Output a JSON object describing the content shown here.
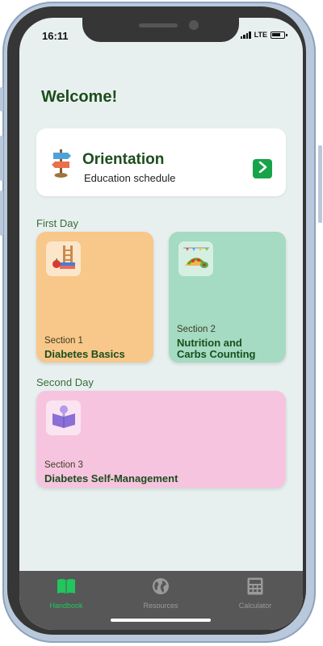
{
  "status_bar": {
    "time": "16:11",
    "network": "LTE"
  },
  "header": {
    "title": "Welcome!"
  },
  "orientation": {
    "title": "Orientation",
    "subtitle": "Education schedule",
    "icon": "signpost-icon"
  },
  "groups": [
    {
      "label": "First Day"
    },
    {
      "label": "Second Day"
    }
  ],
  "sections": [
    {
      "section_label": "Section 1",
      "title": "Diabetes Basics",
      "title_line2": "",
      "color": "#f8c78a",
      "icon": "books-icon"
    },
    {
      "section_label": "Section 2",
      "title": "Nutrition and",
      "title_line2": "Carbs Counting",
      "color": "#a4dbc2",
      "icon": "taco-icon"
    },
    {
      "section_label": "Section 3",
      "title": "Diabetes Self-Management",
      "title_line2": "",
      "color": "#f7c4e0",
      "icon": "open-book-icon"
    }
  ],
  "tabbar": {
    "items": [
      {
        "label": "Handbook",
        "icon": "book-icon",
        "active": true
      },
      {
        "label": "Resources",
        "icon": "globe-icon",
        "active": false
      },
      {
        "label": "Calculator",
        "icon": "calculator-icon",
        "active": false
      }
    ],
    "active_color": "#22c55e",
    "inactive_color": "#9a9a9a"
  }
}
